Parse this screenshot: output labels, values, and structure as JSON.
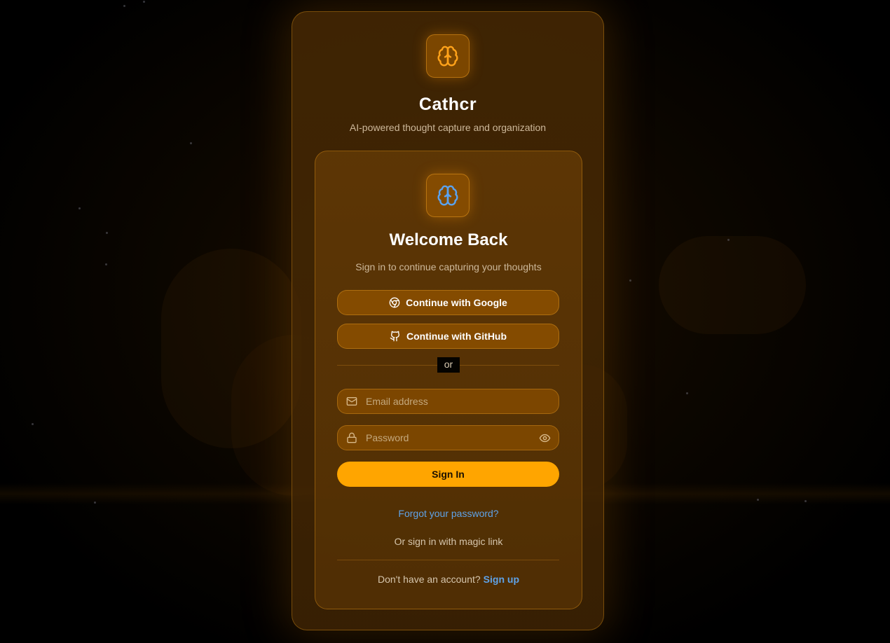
{
  "app": {
    "name": "Cathcr",
    "tagline": "AI-powered thought capture and organization",
    "logo_icon": "brain-icon",
    "accent": "#ffa500"
  },
  "card": {
    "icon": "brain-icon",
    "title": "Welcome Back",
    "subtitle": "Sign in to continue capturing your thoughts"
  },
  "oauth": {
    "google_label": "Continue with Google",
    "google_icon": "chrome-icon",
    "github_label": "Continue with GitHub",
    "github_icon": "github-icon"
  },
  "divider": {
    "label": "or"
  },
  "form": {
    "email_placeholder": "Email address",
    "email_icon": "mail-icon",
    "password_placeholder": "Password",
    "password_icon": "lock-icon",
    "toggle_icon": "eye-icon",
    "submit_label": "Sign In"
  },
  "links": {
    "forgot": "Forgot your password?",
    "magic": "Or sign in with magic link",
    "signup_prompt": "Don't have an account?",
    "signup": "Sign up"
  },
  "colors": {
    "link": "#5fa3e8",
    "logo_orange": "#ffa21a",
    "logo_blue": "#5aa3f0"
  }
}
